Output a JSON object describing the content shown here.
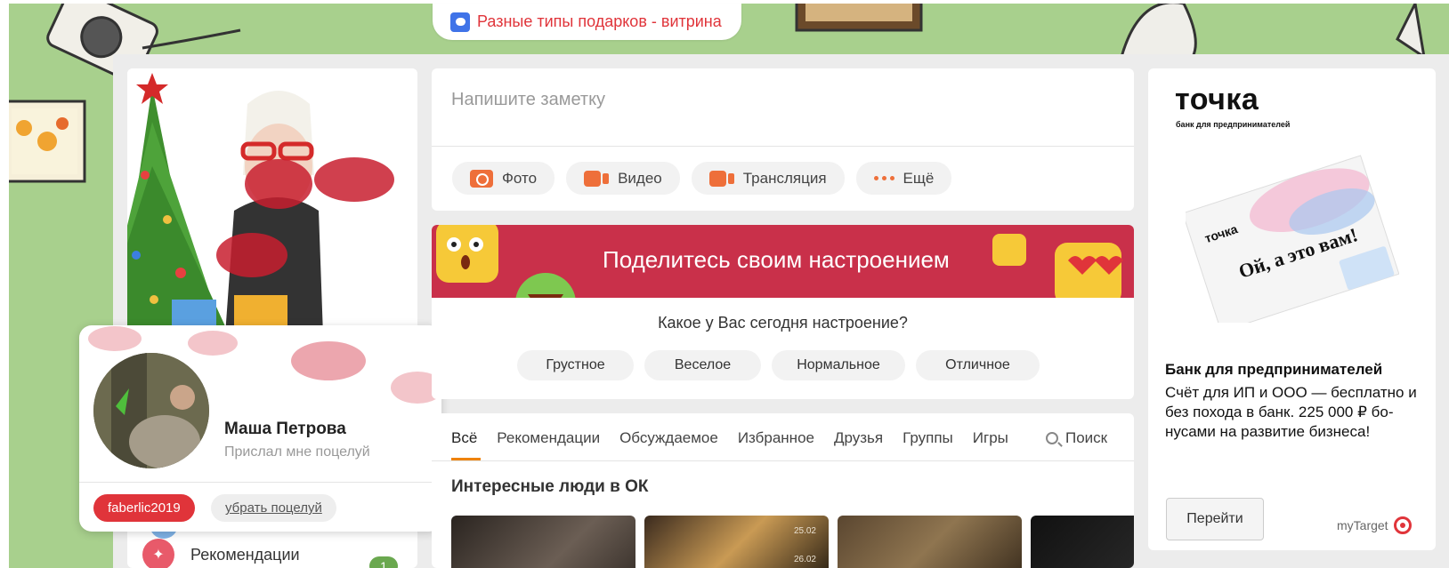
{
  "gift_banner": {
    "label": "Разные типы подарков - витрина"
  },
  "note": {
    "placeholder": "Напишите заметку",
    "buttons": [
      {
        "label": "Фото",
        "icon": "camera-icon"
      },
      {
        "label": "Видео",
        "icon": "video-icon"
      },
      {
        "label": "Трансляция",
        "icon": "stream-icon"
      },
      {
        "label": "Ещё",
        "icon": "more-dots-icon"
      }
    ]
  },
  "mood": {
    "banner_text": "Поделитесь своим настроением",
    "question": "Какое у Вас сегодня настроение?",
    "options": [
      "Грустное",
      "Веселое",
      "Нормальное",
      "Отличное"
    ]
  },
  "feed": {
    "tabs": [
      "Всё",
      "Рекомендации",
      "Обсуждаемое",
      "Избранное",
      "Друзья",
      "Группы",
      "Игры"
    ],
    "active_tab": "Всё",
    "search_label": "Поиск",
    "section_title": "Интересные люди в ОК",
    "card2_dates": [
      "25.02",
      "26.02"
    ]
  },
  "notification": {
    "sender_name": "Маша Петрова",
    "subtitle": "Прислал мне поцелуй",
    "tag": "faberlic2019",
    "remove_label": "убрать поцелуй"
  },
  "left_nav": {
    "recommendations_label": "Рекомендации",
    "recommendations_badge": "1"
  },
  "ad": {
    "logo": "точка",
    "logo_sub": "банк для предпринимателей",
    "box_brand": "точка",
    "box_slogan": "Ой, а это вам!",
    "title": "Банк для предпринимателей",
    "text": "Счёт для ИП и ООО — бесплатно и без похода в банк. 225 000 ₽ бо-нусами на развитие бизнеса!",
    "button": "Перейти",
    "network": "myTarget"
  },
  "colors": {
    "accent_orange": "#ee8208",
    "brand_red": "#e0343a",
    "mood_banner": "#c9304a",
    "background_green": "#a8d08d"
  }
}
